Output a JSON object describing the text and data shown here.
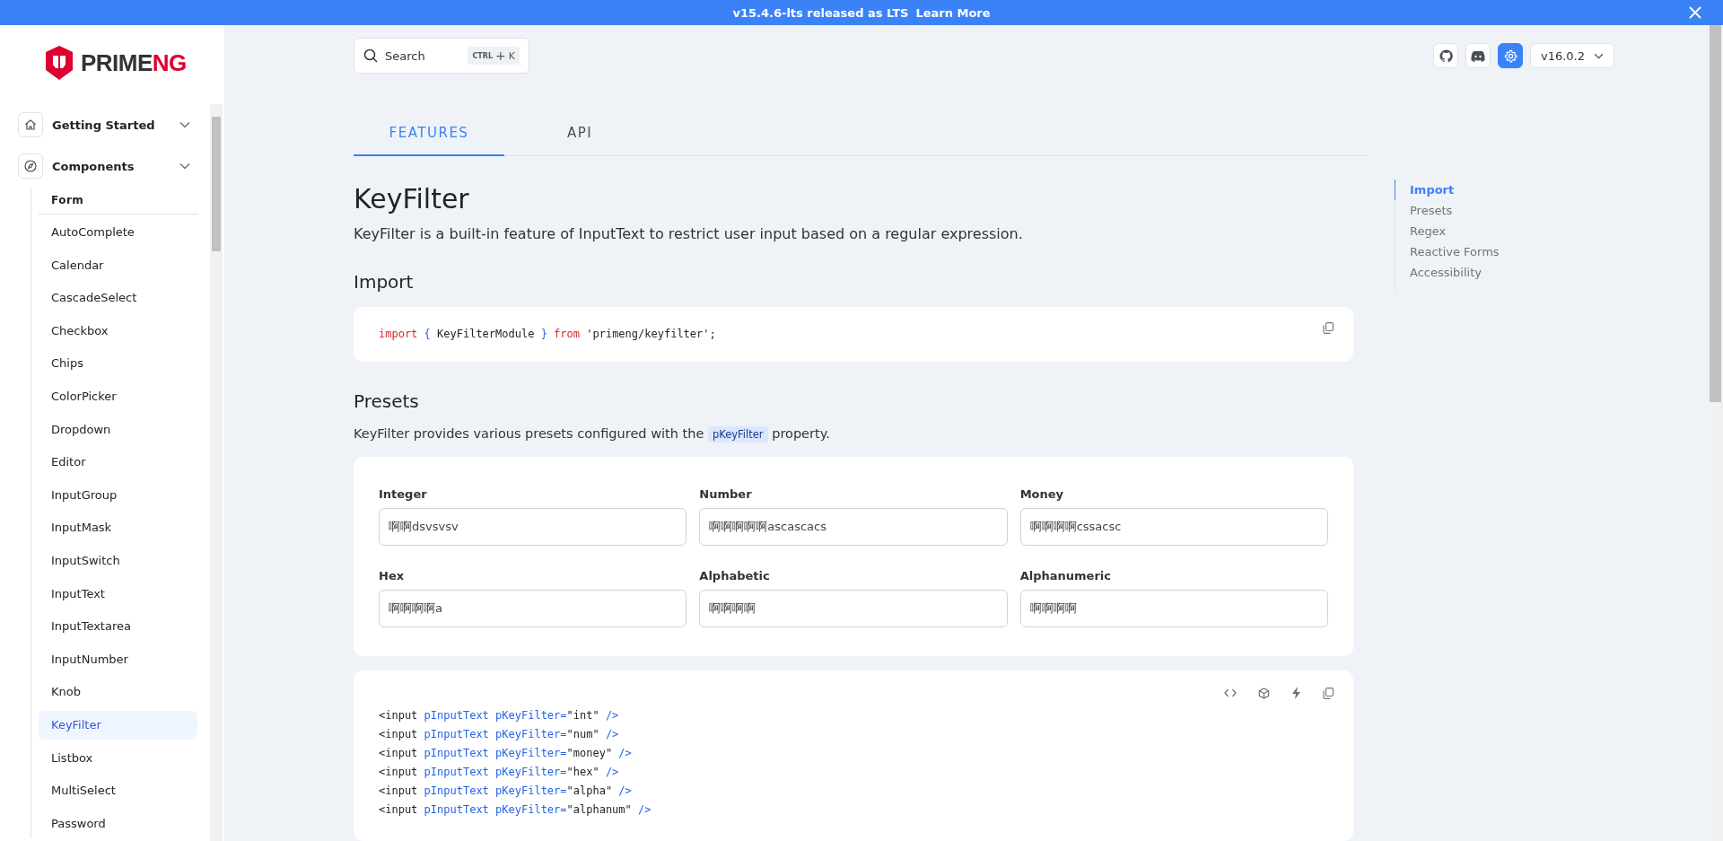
{
  "banner": {
    "text": "v15.4.6-lts released as LTS",
    "link": "Learn More"
  },
  "logo": {
    "text_a": "PRIME",
    "text_b": "NG"
  },
  "search": {
    "placeholder": "Search",
    "shortcut_a": "CTRL",
    "shortcut_b": "+",
    "shortcut_c": "K"
  },
  "version": {
    "label": "v16.0.2"
  },
  "sidebar": {
    "sections": [
      {
        "label": "Getting Started",
        "kind": "home"
      },
      {
        "label": "Components",
        "kind": "compass"
      }
    ],
    "group": "Form",
    "items": [
      {
        "label": "AutoComplete",
        "selected": false
      },
      {
        "label": "Calendar",
        "selected": false
      },
      {
        "label": "CascadeSelect",
        "selected": false
      },
      {
        "label": "Checkbox",
        "selected": false
      },
      {
        "label": "Chips",
        "selected": false
      },
      {
        "label": "ColorPicker",
        "selected": false
      },
      {
        "label": "Dropdown",
        "selected": false
      },
      {
        "label": "Editor",
        "selected": false
      },
      {
        "label": "InputGroup",
        "selected": false
      },
      {
        "label": "InputMask",
        "selected": false
      },
      {
        "label": "InputSwitch",
        "selected": false
      },
      {
        "label": "InputText",
        "selected": false
      },
      {
        "label": "InputTextarea",
        "selected": false
      },
      {
        "label": "InputNumber",
        "selected": false
      },
      {
        "label": "Knob",
        "selected": false
      },
      {
        "label": "KeyFilter",
        "selected": true
      },
      {
        "label": "Listbox",
        "selected": false
      },
      {
        "label": "MultiSelect",
        "selected": false
      },
      {
        "label": "Password",
        "selected": false
      }
    ]
  },
  "tabs": [
    {
      "label": "FEATURES",
      "selected": true
    },
    {
      "label": "API",
      "selected": false
    }
  ],
  "title": "KeyFilter",
  "description": "KeyFilter is a built-in feature of InputText to restrict user input based on a regular expression.",
  "import_section": {
    "heading": "Import",
    "code": [
      [
        {
          "kind": "keyword",
          "text": "import"
        },
        {
          "kind": "punct",
          "text": " { "
        },
        {
          "kind": "plain",
          "text": "KeyFilterModule"
        },
        {
          "kind": "punct",
          "text": " } "
        },
        {
          "kind": "keyword",
          "text": "from"
        },
        {
          "kind": "plain",
          "text": " 'primeng/keyfilter';"
        }
      ]
    ]
  },
  "presets_section": {
    "heading": "Presets",
    "description_before": "KeyFilter provides various presets configured with the",
    "description_code": "pKeyFilter",
    "description_after": "property.",
    "fields": [
      {
        "label": "Integer",
        "value": "啊啊dsvsvsv"
      },
      {
        "label": "Number",
        "value": "啊啊啊啊啊ascascacs"
      },
      {
        "label": "Money",
        "value": "啊啊啊啊cssacsc"
      },
      {
        "label": "Hex",
        "value": "啊啊啊啊a"
      },
      {
        "label": "Alphabetic",
        "value": "啊啊啊啊"
      },
      {
        "label": "Alphanumeric",
        "value": "啊啊啊啊"
      }
    ],
    "code": [
      [
        {
          "kind": "plain",
          "text": "<input"
        },
        {
          "kind": "attr",
          "text": " pInputText pKeyFilter="
        },
        {
          "kind": "plain",
          "text": "\"int\""
        },
        {
          "kind": "attr",
          "text": " />"
        }
      ],
      [
        {
          "kind": "plain",
          "text": "<input"
        },
        {
          "kind": "attr",
          "text": " pInputText pKeyFilter="
        },
        {
          "kind": "plain",
          "text": "\"num\""
        },
        {
          "kind": "attr",
          "text": " />"
        }
      ],
      [
        {
          "kind": "plain",
          "text": "<input"
        },
        {
          "kind": "attr",
          "text": " pInputText pKeyFilter="
        },
        {
          "kind": "plain",
          "text": "\"money\""
        },
        {
          "kind": "attr",
          "text": " />"
        }
      ],
      [
        {
          "kind": "plain",
          "text": "<input"
        },
        {
          "kind": "attr",
          "text": " pInputText pKeyFilter="
        },
        {
          "kind": "plain",
          "text": "\"hex\""
        },
        {
          "kind": "attr",
          "text": " />"
        }
      ],
      [
        {
          "kind": "plain",
          "text": "<input"
        },
        {
          "kind": "attr",
          "text": " pInputText pKeyFilter="
        },
        {
          "kind": "plain",
          "text": "\"alpha\""
        },
        {
          "kind": "attr",
          "text": " />"
        }
      ],
      [
        {
          "kind": "plain",
          "text": "<input"
        },
        {
          "kind": "attr",
          "text": " pInputText pKeyFilter="
        },
        {
          "kind": "plain",
          "text": "\"alphanum\""
        },
        {
          "kind": "attr",
          "text": " />"
        }
      ]
    ]
  },
  "toc": [
    {
      "label": "Import",
      "selected": true
    },
    {
      "label": "Presets",
      "selected": false
    },
    {
      "label": "Regex",
      "selected": false
    },
    {
      "label": "Reactive Forms",
      "selected": false
    },
    {
      "label": "Accessibility",
      "selected": false
    }
  ]
}
